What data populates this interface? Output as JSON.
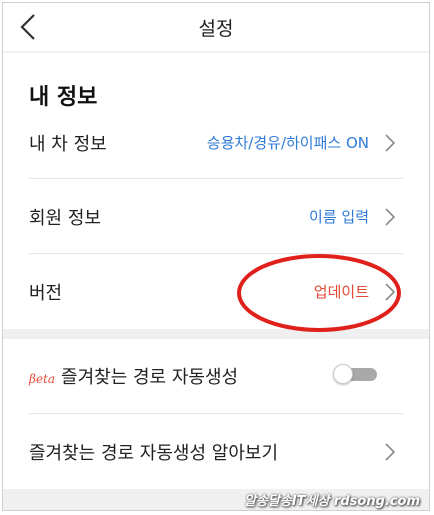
{
  "header": {
    "title": "설정",
    "back_icon": "chevron-left-icon"
  },
  "section": {
    "title": "내 정보"
  },
  "rows": [
    {
      "label": "내 차 정보",
      "value": "승용차/경유/하이패스 ON",
      "icon": "chevron-right-icon"
    },
    {
      "label": "회원 정보",
      "value": "이름 입력",
      "icon": "chevron-right-icon"
    },
    {
      "label": "버전",
      "value": "업데이트",
      "icon": "chevron-right-icon"
    }
  ],
  "auto_route": {
    "beta_badge": "βeta",
    "label": "즐겨찾는 경로 자동생성",
    "toggle_on": false
  },
  "learn_more": {
    "label": "즐겨찾는 경로 자동생성 알아보기",
    "icon": "chevron-right-icon"
  },
  "watermark": "알송달송IT세상 rdsong.com",
  "colors": {
    "link_blue": "#2f7bd8",
    "update_red": "#e34a36",
    "highlight_red": "#e0201b",
    "divider": "#e6e6e6",
    "section_gap": "#f0f0f0"
  }
}
